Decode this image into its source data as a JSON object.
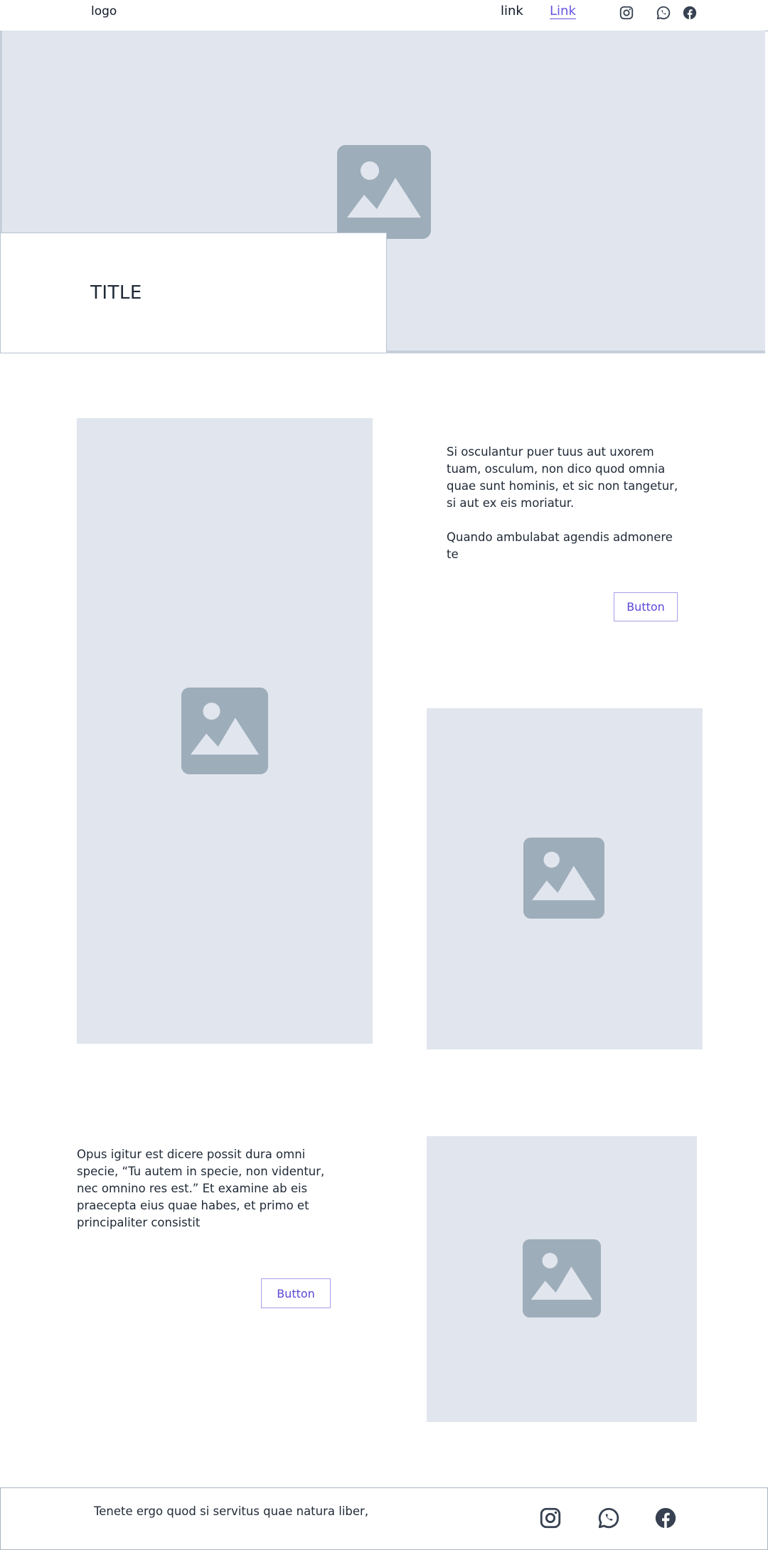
{
  "header": {
    "logo": "logo",
    "links": [
      "link",
      "Link"
    ],
    "social_icons": [
      "instagram-icon",
      "whatsapp-icon",
      "facebook-icon"
    ]
  },
  "hero": {
    "title": "TITLE",
    "image_icon": "image-placeholder-icon"
  },
  "section1": {
    "paragraph1": "Si osculantur puer tuus aut uxorem tuam, osculum, non dico quod omnia quae sunt hominis, et sic non tangetur, si aut ex eis moriatur.",
    "paragraph2": "Quando ambulabat agendis admonere te",
    "button_label": "Button"
  },
  "section2": {
    "paragraph": "Opus igitur est dicere possit dura omni specie, “Tu autem in specie, non videntur, nec omnino res est.” Et examine ab eis praecepta eius quae habes, et primo et principaliter consistit",
    "button_label": "Button"
  },
  "footer": {
    "text": "Tenete ergo quod si servitus quae natura liber,",
    "social_icons": [
      "instagram-icon",
      "whatsapp-icon",
      "facebook-icon"
    ]
  },
  "colors": {
    "accent": "#6554e0",
    "placeholder_bg": "#e1e6ee",
    "placeholder_icon": "#9eadba",
    "text": "#1f2937"
  }
}
